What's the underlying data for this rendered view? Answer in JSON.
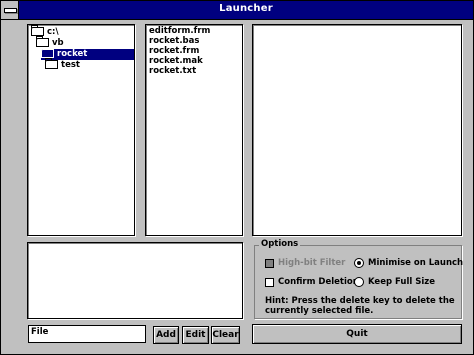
{
  "window": {
    "title": "Launcher"
  },
  "tree": {
    "items": [
      {
        "label": "c:\\",
        "selected": false
      },
      {
        "label": "vb",
        "selected": false
      },
      {
        "label": "rocket",
        "selected": true
      },
      {
        "label": "test",
        "selected": false
      }
    ]
  },
  "files": [
    "editform.frm",
    "rocket.bas",
    "rocket.frm",
    "rocket.mak",
    "rocket.txt"
  ],
  "options": {
    "group_label": "Options",
    "high_bit_filter": {
      "label": "High-bit Filter",
      "checked": false,
      "enabled": false
    },
    "confirm_deletions": {
      "label": "Confirm Deletions",
      "checked": false
    },
    "minimise_on_launch": {
      "label": "Minimise on Launch",
      "selected": true
    },
    "keep_full_size": {
      "label": "Keep Full Size",
      "selected": false
    },
    "hint": "Hint: Press the delete key to delete the currently selected file."
  },
  "input": {
    "value": "File"
  },
  "buttons": {
    "add": "Add",
    "edit": "Edit",
    "clear": "Clear",
    "quit": "Quit"
  }
}
